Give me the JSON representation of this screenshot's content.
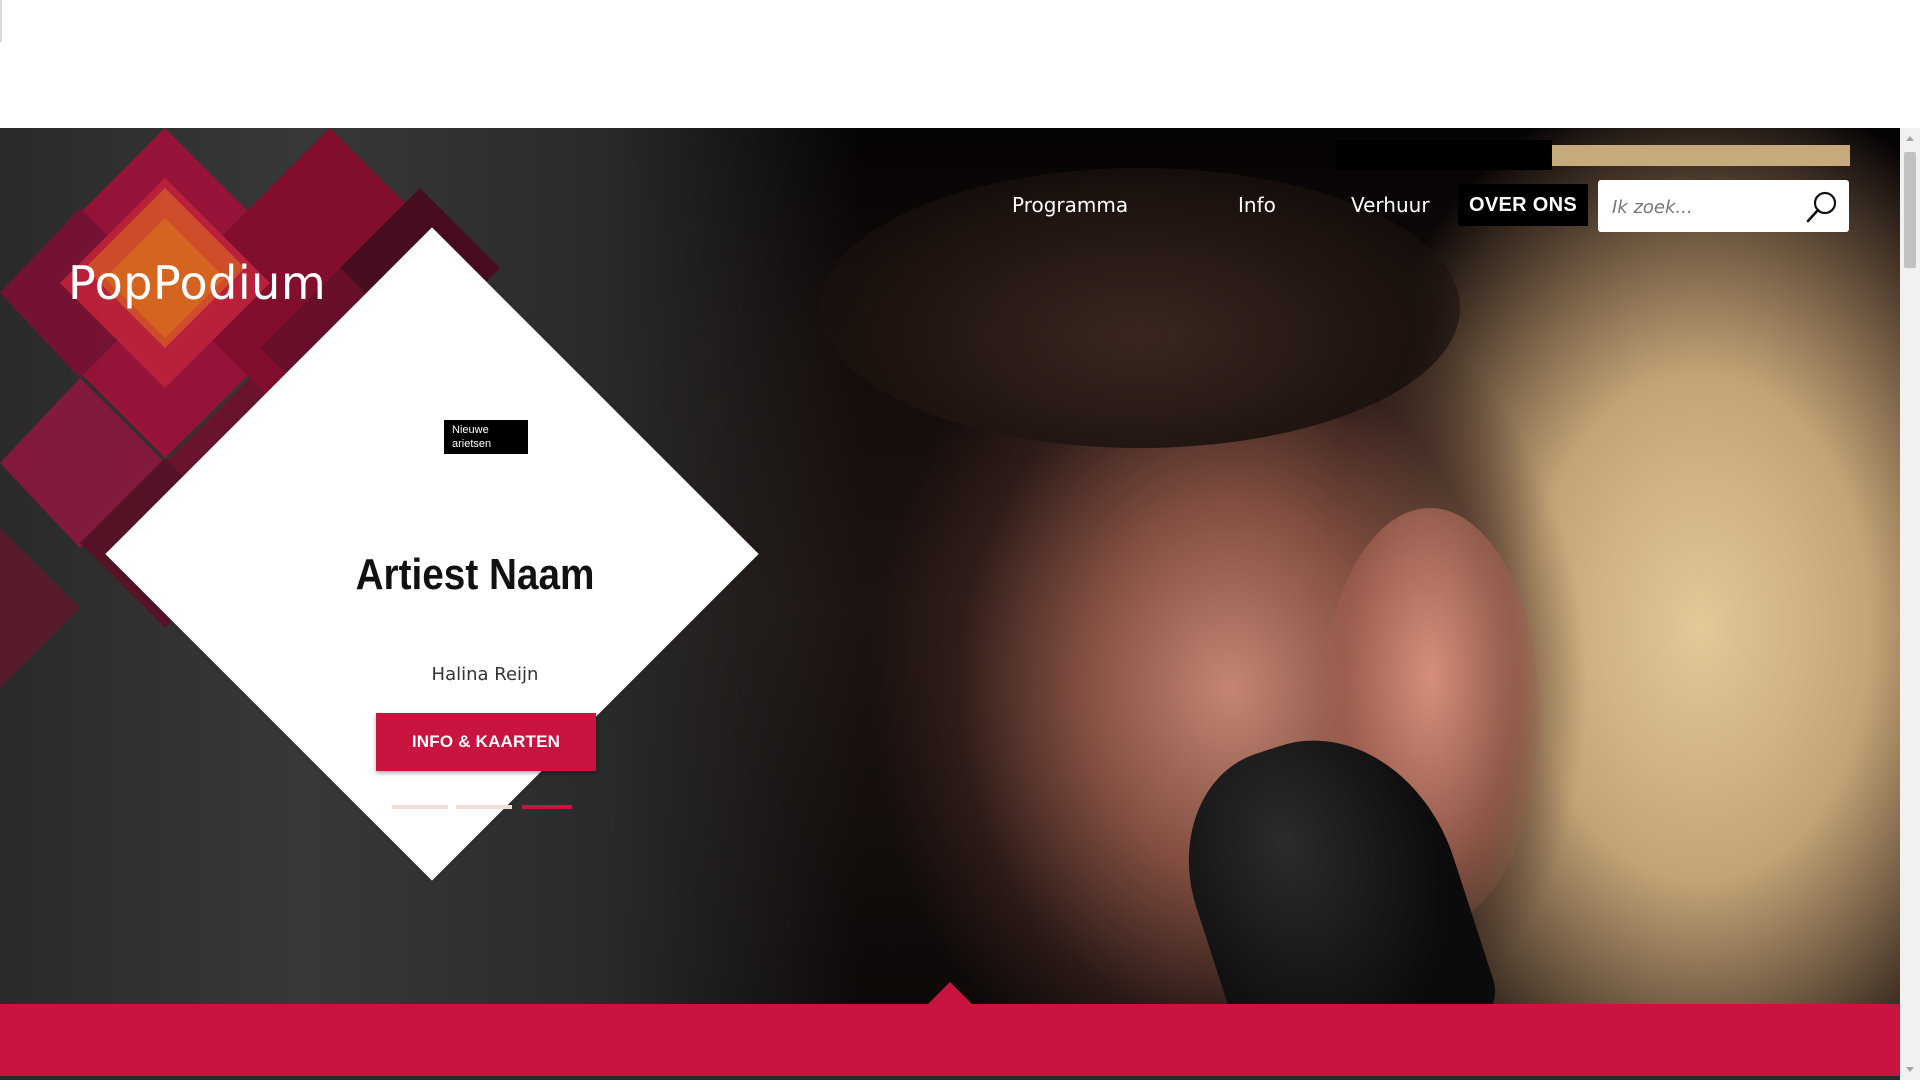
{
  "site": {
    "logo": "PopPodium"
  },
  "nav": {
    "items": [
      {
        "label": "Programma"
      },
      {
        "label": "Info"
      },
      {
        "label": "Verhuur"
      },
      {
        "label": "OVER ONS"
      }
    ]
  },
  "search": {
    "placeholder": "Ik zoek...",
    "value": "",
    "icon": "search-icon"
  },
  "feature": {
    "badge": "Nieuwe arietsen",
    "title": "Artiest Naam",
    "subtitle": "Halina Reijn",
    "cta_label": "INFO & KAARTEN",
    "slides": 3,
    "active_slide": 3
  },
  "colors": {
    "accent": "#c8143f",
    "gold": "#c6aa7b",
    "black": "#000000"
  }
}
